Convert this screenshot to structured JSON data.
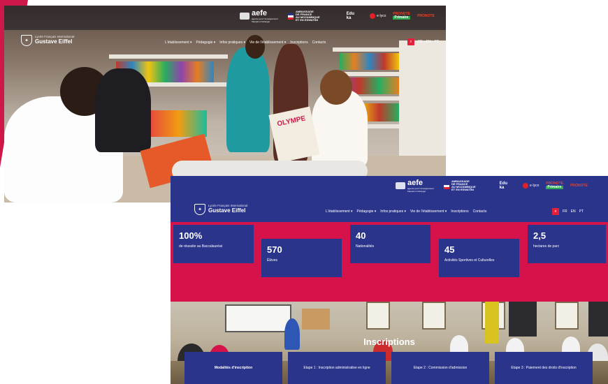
{
  "site": {
    "logo_small": "Lycée Français International",
    "logo_name": "Gustave Eiffel",
    "nav": [
      "L'établissement ▾",
      "Pédagogie ▾",
      "Infos pratiques ▾",
      "Vie de l'établissement ▾",
      "Inscriptions",
      "Contacts"
    ],
    "languages": [
      "FR",
      "EN",
      "PT"
    ],
    "search_icon": "search-icon"
  },
  "partners": {
    "aefe": "aefe",
    "aefe_sub": "agence pour l'enseignement français à l'étranger",
    "ambassade": [
      "AMBASSADE",
      "DE FRANCE",
      "AU MOZAMBIQUE",
      "ET EN ESWATINI"
    ],
    "edu": [
      "Edu",
      "ka"
    ],
    "red_logo": "e·lyco",
    "pronote_top": "PRONOTE",
    "pronote_bottom": "Primaire",
    "pronote_right": "PRONOTE"
  },
  "stats": [
    {
      "value": "100%",
      "label": "de réussite au Baccalauréat"
    },
    {
      "value": "570",
      "label": "Élèves"
    },
    {
      "value": "40",
      "label": "Nationalités"
    },
    {
      "value": "45",
      "label": "Activités Sportives et Culturelles"
    },
    {
      "value": "2,5",
      "label": "hectares de parc"
    }
  ],
  "inscriptions": {
    "title": "Inscriptions",
    "cards": [
      "Modalités d'inscription",
      "Etape 1 : Inscription administrative en ligne",
      "Etape 2 : Commission d'admission",
      "Etape 3 : Paiement des droits d'inscription"
    ]
  },
  "book_title": "OLYMPE"
}
